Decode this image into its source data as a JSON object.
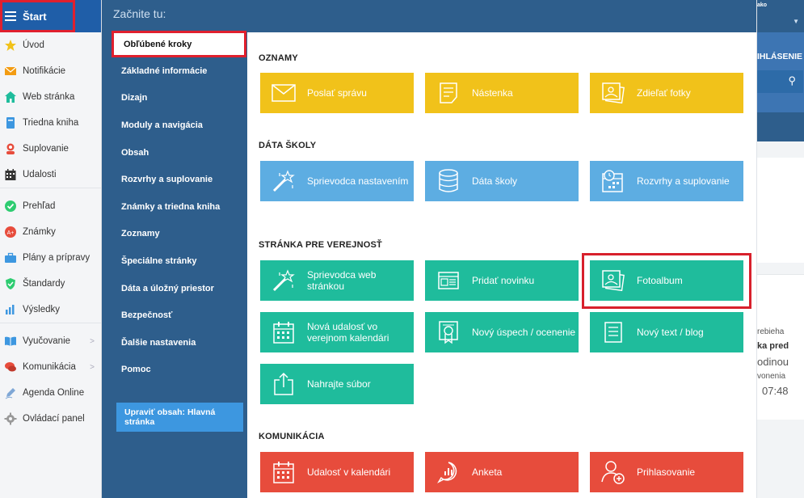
{
  "sidebar": {
    "start_label": "Štart",
    "groups": [
      [
        {
          "label": "Úvod",
          "icon": "star-icon",
          "color": "#f1c21a"
        },
        {
          "label": "Notifikácie",
          "icon": "envelope-icon",
          "color": "#f39c12"
        },
        {
          "label": "Web stránka",
          "icon": "home-icon",
          "color": "#1fbc9c"
        },
        {
          "label": "Triedna kniha",
          "icon": "book-icon",
          "color": "#3d97e0"
        },
        {
          "label": "Suplovanie",
          "icon": "user-swap-icon",
          "color": "#e74c3c"
        },
        {
          "label": "Udalosti",
          "icon": "calendar-icon",
          "color": "#333333"
        }
      ],
      [
        {
          "label": "Prehľad",
          "icon": "check-circle-icon",
          "color": "#2ecc71"
        },
        {
          "label": "Známky",
          "icon": "grade-icon",
          "color": "#e74c3c"
        },
        {
          "label": "Plány a prípravy",
          "icon": "briefcase-icon",
          "color": "#3d97e0"
        },
        {
          "label": "Štandardy",
          "icon": "shield-icon",
          "color": "#2ecc71"
        },
        {
          "label": "Výsledky",
          "icon": "bar-chart-icon",
          "color": "#3d97e0"
        }
      ],
      [
        {
          "label": "Vyučovanie",
          "icon": "open-book-icon",
          "color": "#3d97e0",
          "chevron": ">"
        },
        {
          "label": "Komunikácia",
          "icon": "chat-icon",
          "color": "#e74c3c",
          "chevron": ">"
        },
        {
          "label": "Agenda Online",
          "icon": "pen-icon",
          "color": "#7fa7d6"
        },
        {
          "label": "Ovládací panel",
          "icon": "gear-icon",
          "color": "#999999"
        }
      ]
    ]
  },
  "menu": {
    "heading": "Začnite tu:",
    "items": [
      "Obľúbené kroky",
      "Základné informácie",
      "Dizajn",
      "Moduly a navigácia",
      "Obsah",
      "Rozvrhy a suplovanie",
      "Známky a triedna kniha",
      "Zoznamy",
      "Špeciálne stránky",
      "Dáta a úložný priestor",
      "Bezpečnosť",
      "Ďalšie nastavenia",
      "Pomoc"
    ],
    "edit_button": "Upraviť obsah: Hlavná stránka"
  },
  "sections": [
    {
      "title": "OZNAMY",
      "tiles": [
        {
          "label": "Poslať správu",
          "icon": "envelope-icon",
          "color": "yellow"
        },
        {
          "label": "Nástenka",
          "icon": "note-icon",
          "color": "yellow"
        },
        {
          "label": "Zdieľať fotky",
          "icon": "photos-icon",
          "color": "yellow"
        }
      ]
    },
    {
      "title": "DÁTA ŠKOLY",
      "tiles": [
        {
          "label": "Sprievodca nastavením",
          "icon": "magic-wand-icon",
          "color": "blue"
        },
        {
          "label": "Dáta školy",
          "icon": "database-icon",
          "color": "blue"
        },
        {
          "label": "Rozvrhy a suplovanie",
          "icon": "calendar-clock-icon",
          "color": "blue"
        }
      ]
    },
    {
      "title": "STRÁNKA PRE VEREJNOSŤ",
      "tiles": [
        {
          "label": "Sprievodca web stránkou",
          "icon": "magic-wand-icon",
          "color": "green"
        },
        {
          "label": "Pridať novinku",
          "icon": "newspaper-icon",
          "color": "green"
        },
        {
          "label": "Fotoalbum",
          "icon": "photos-icon",
          "color": "green"
        },
        {
          "label": "Nová udalosť vo verejnom kalendári",
          "icon": "calendar-icon",
          "color": "green"
        },
        {
          "label": "Nový úspech / ocenenie",
          "icon": "certificate-icon",
          "color": "green"
        },
        {
          "label": "Nový text / blog",
          "icon": "document-icon",
          "color": "green"
        },
        {
          "label": "Nahrajte súbor",
          "icon": "upload-icon",
          "color": "green"
        }
      ]
    },
    {
      "title": "KOMUNIKÁCIA",
      "tiles": [
        {
          "label": "Udalosť v kalendári",
          "icon": "calendar-icon",
          "color": "red"
        },
        {
          "label": "Anketa",
          "icon": "poll-icon",
          "color": "red"
        },
        {
          "label": "Prihlasovanie",
          "icon": "add-user-icon",
          "color": "red"
        }
      ]
    }
  ],
  "right_bg": {
    "user_partial": "ako",
    "login_partial": "IHLÁSENIE",
    "lines": [
      "rebieha",
      "ka pred",
      "odinou",
      "vonenia",
      "07:48"
    ]
  },
  "colors": {
    "yellow": "#f1c21a",
    "blue": "#5dade2",
    "green": "#1fbc9c",
    "red": "#e74c3c",
    "panel": "#2e5e8c",
    "start_bar": "#1f5ea8",
    "highlight": "#e0202e"
  }
}
